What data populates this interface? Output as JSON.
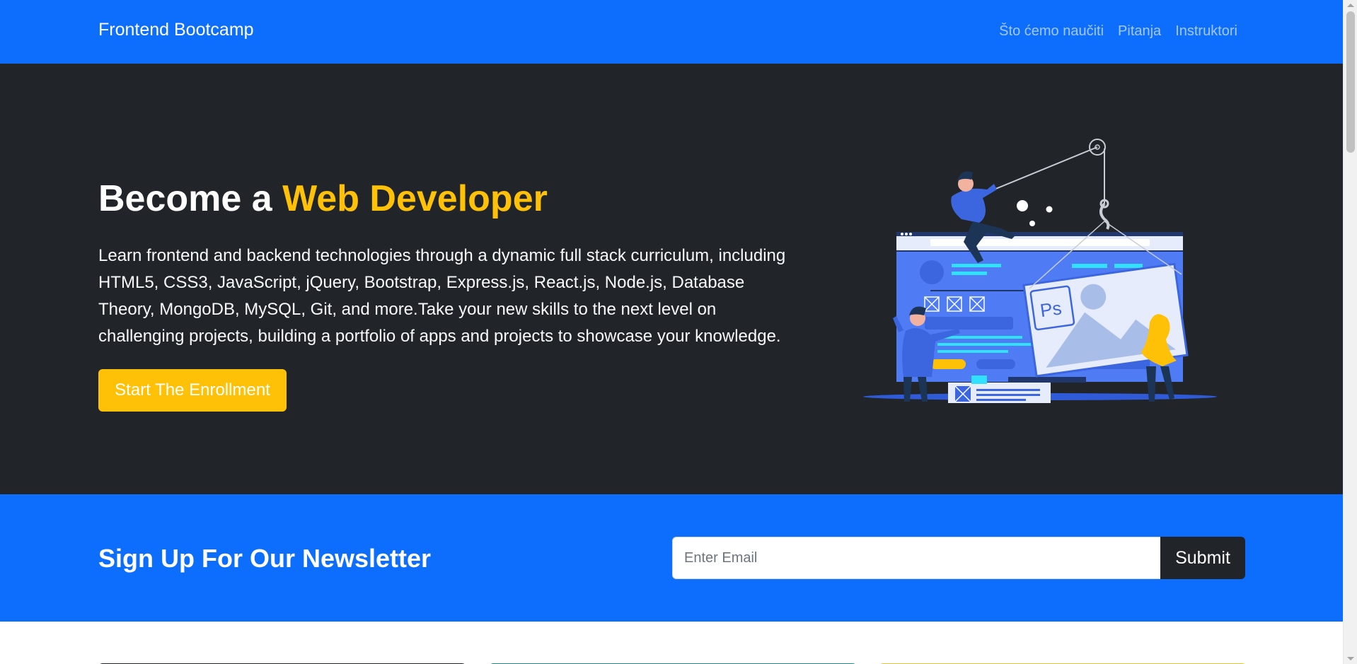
{
  "navbar": {
    "brand": "Frontend Bootcamp",
    "links": [
      "Što ćemo naučiti",
      "Pitanja",
      "Instruktori"
    ]
  },
  "hero": {
    "title_prefix": "Become a ",
    "title_highlight": "Web Developer",
    "description": "Learn frontend and backend technologies through a dynamic full stack curriculum, including HTML5, CSS3, JavaScript, jQuery, Bootstrap, Express.js, React.js, Node.js, Database Theory, MongoDB, MySQL, Git, and more.Take your new skills to the next level on challenging projects, building a portfolio of apps and projects to showcase your knowledge.",
    "cta_label": "Start The Enrollment",
    "illustration_label": "Ps"
  },
  "newsletter": {
    "title": "Sign Up For Our Newsletter",
    "email_placeholder": "Enter Email",
    "email_value": "",
    "submit_label": "Submit"
  },
  "colors": {
    "primary": "#0d6efd",
    "dark": "#212529",
    "warning": "#ffc107",
    "white": "#ffffff"
  },
  "icons": {
    "hero_illustration": "developer-illustration",
    "scroll_up": "arrow-up-icon",
    "scroll_down": "arrow-down-icon"
  }
}
